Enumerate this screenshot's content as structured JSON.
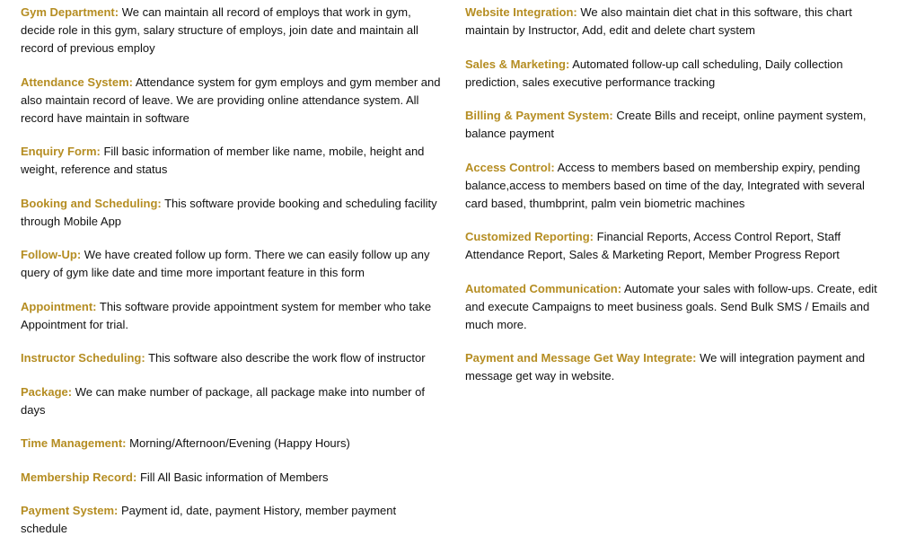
{
  "accent_color": "#b58d22",
  "left_column": [
    {
      "label": "Gym Department:",
      "text": "We can maintain all record of employs that work in gym, decide role in this gym, salary structure of employs, join date and maintain all record of previous employ"
    },
    {
      "label": "Attendance System:",
      "text": "Attendance system for gym employs and gym member and also maintain record of leave. We are providing online attendance system. All record have maintain in software"
    },
    {
      "label": "Enquiry Form:",
      "text": "Fill basic information of member like name, mobile, height and weight, reference and status"
    },
    {
      "label": "Booking and Scheduling:",
      "text": "This software provide booking and scheduling facility through Mobile App"
    },
    {
      "label": "Follow-Up:",
      "text": "We have created follow up form. There we can easily follow up any query of gym like date and time more important feature in this form"
    },
    {
      "label": "Appointment:",
      "text": "This software provide appointment system for member who take Appointment for trial."
    },
    {
      "label": "Instructor Scheduling:",
      "text": "This software also describe the work flow of instructor"
    },
    {
      "label": "Package:",
      "text": "We can make number of package, all package make into number of days"
    },
    {
      "label": "Time Management:",
      "text": "Morning/Afternoon/Evening (Happy Hours)"
    },
    {
      "label": "Membership Record:",
      "text": "Fill All Basic information of Members"
    },
    {
      "label": "Payment System:",
      "text": "Payment id, date, payment History, member payment schedule"
    }
  ],
  "right_column": [
    {
      "label": "Website Integration:",
      "text": "We also maintain diet chat in this software, this chart maintain by Instructor, Add, edit and delete chart system"
    },
    {
      "label": "Sales & Marketing:",
      "text": "Automated follow-up call scheduling, Daily collection prediction, sales executive performance tracking"
    },
    {
      "label": "Billing & Payment System:",
      "text": "Create Bills and receipt, online payment system, balance payment"
    },
    {
      "label": "Access Control:",
      "text": "Access to members based on membership expiry, pending balance,access to members based on time of the day, Integrated with several card based, thumbprint, palm vein biometric machines"
    },
    {
      "label": "Customized Reporting:",
      "text": "Financial Reports, Access Control Report, Staff Attendance Report, Sales & Marketing Report, Member Progress Report"
    },
    {
      "label": "Automated Communication:",
      "text": "Automate your sales with follow-ups. Create, edit and execute Campaigns to meet business goals. Send Bulk SMS / Emails and much more."
    },
    {
      "label": "Payment and Message Get Way Integrate:",
      "text": "We will integration payment and message get way in website."
    }
  ]
}
